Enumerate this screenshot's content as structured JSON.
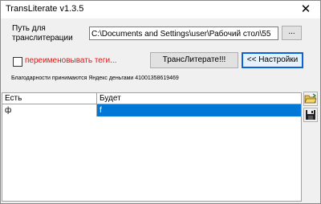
{
  "window": {
    "title": "TransLiterate v1.3.5",
    "close_glyph": "✕"
  },
  "path": {
    "label_line1": "Путь для",
    "label_line2": "транслитерации",
    "value": "C:\\Documents and Settings\\user\\Рабочий стол\\55",
    "browse_label": "..."
  },
  "options": {
    "rename_tags_label": "переименовывать теги...",
    "rename_tags_checked": false
  },
  "buttons": {
    "transliterate_label": "ТрансЛитерате!!!",
    "settings_label": "<< Настройки"
  },
  "thanks_text": "Благодарности принимаются Яндекс деньгами 41001358619469",
  "table": {
    "columns": [
      "Есть",
      "Будет"
    ],
    "rows": [
      {
        "is": "ф",
        "will_be": "f",
        "selected": true
      }
    ]
  },
  "icons": {
    "open": "open-folder-icon",
    "save": "save-disk-icon"
  },
  "colors": {
    "selection": "#0078d7",
    "label_red": "#e01818",
    "focus_border": "#0a64d8"
  }
}
